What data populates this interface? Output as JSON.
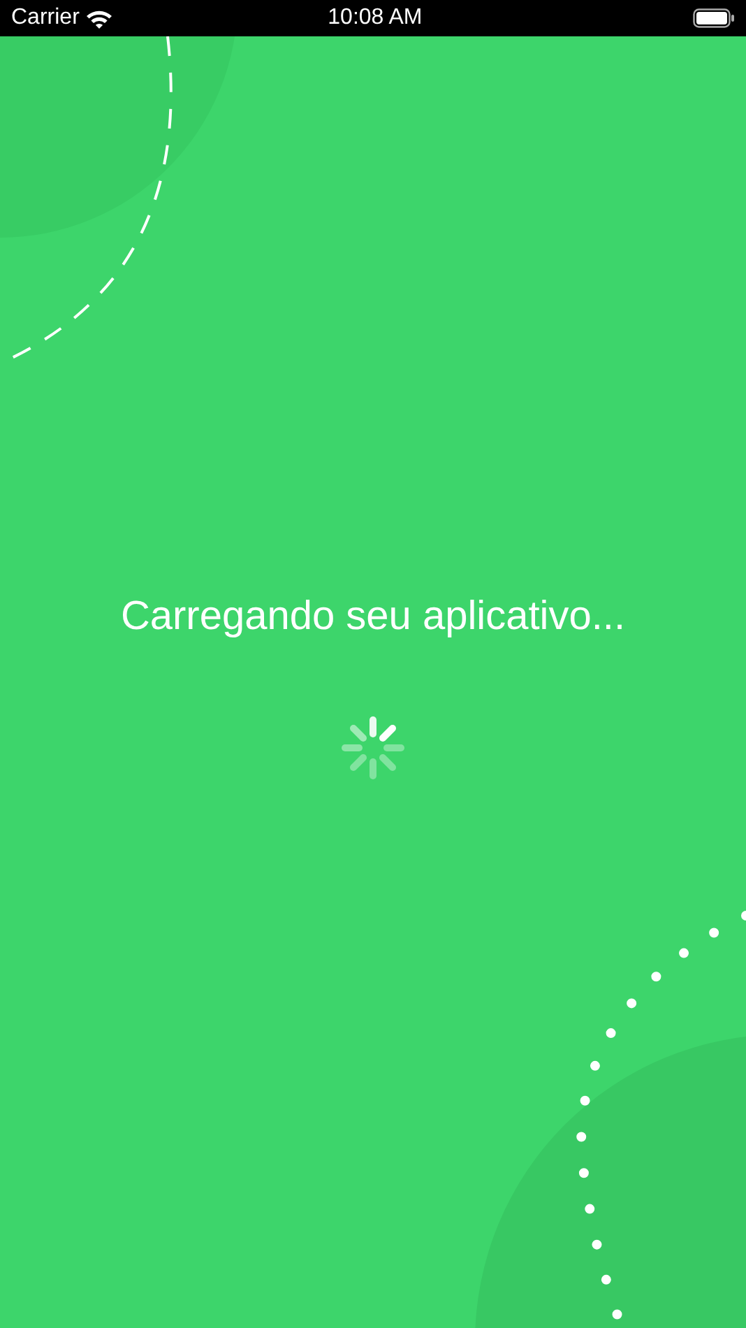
{
  "status_bar": {
    "carrier": "Carrier",
    "time": "10:08 AM"
  },
  "loading": {
    "message": "Carregando seu aplicativo..."
  }
}
